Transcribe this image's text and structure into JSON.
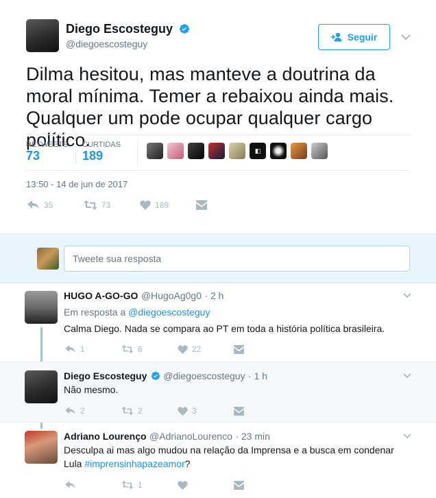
{
  "tweet": {
    "author_name": "Diego Escosteguy",
    "author_handle": "@diegoescosteguy",
    "follow_label": "Seguir",
    "text": "Dilma hesitou, mas manteve a doutrina da moral mínima. Temer a rebaixou ainda mais. Qualquer um pode ocupar qualquer cargo político.",
    "retweets_label": "RETWEETS",
    "retweets_count": "73",
    "likes_label": "CURTIDAS",
    "likes_count": "189",
    "timestamp": "13:50 - 14 de jun de 2017",
    "actions": {
      "replies": "35",
      "retweets": "73",
      "likes": "189"
    }
  },
  "reply_box": {
    "placeholder": "Tweete sua resposta"
  },
  "replies": [
    {
      "name": "HUGO A-GO-GO",
      "handle": "@HugoAg0g0",
      "time": "· 2 h",
      "in_reply_prefix": "Em resposta a ",
      "in_reply_to": "@diegoescosteguy",
      "text": "Calma Diego. Nada se compara ao PT em toda a história política brasileira.",
      "actions": {
        "replies": "1",
        "retweets": "6",
        "likes": "22"
      }
    },
    {
      "name": "Diego Escosteguy",
      "handle": "@diegoescosteguy",
      "time": "· 1 h",
      "text": "Não mesmo.",
      "actions": {
        "replies": "2",
        "retweets": "2",
        "likes": "3"
      }
    },
    {
      "name": "Adriano Lourenço",
      "handle": "@AdrianoLourenco",
      "time": "· 23 min",
      "text_line1": "Desculpa ai mas algo mudou na relação da Imprensa e a busca em condenar",
      "text_line2_prefix": "Lula ",
      "hashtag": "#imprensinhapazeamor",
      "text_line2_suffix": "?",
      "actions": {
        "replies": "",
        "retweets": "1",
        "likes": ""
      }
    }
  ],
  "colors": {
    "accent": "#1da1f2",
    "link": "#1b95e0",
    "muted": "#657786",
    "icon": "#aab8c2",
    "reply_bg": "#e8f5fd",
    "thread_line": "#88c9f9"
  }
}
